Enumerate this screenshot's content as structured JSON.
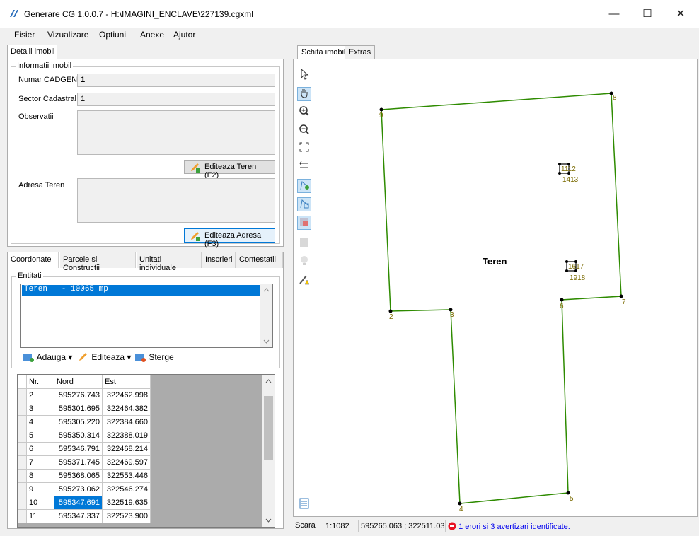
{
  "window": {
    "title": "Generare CG 1.0.0.7 - H:\\IMAGINI_ENCLAVE\\227139.cgxml",
    "minimize": "—",
    "maximize": "☐",
    "close": "✕"
  },
  "menu": [
    "Fisier",
    "Vizualizare",
    "Optiuni",
    "Anexe",
    "Ajutor"
  ],
  "left": {
    "tab": "Detalii imobil",
    "info_group": "Informatii imobil",
    "numar_cadgen_label": "Numar CADGEN",
    "numar_cadgen_value": "1",
    "sector_label": "Sector Cadastral",
    "sector_value": "1",
    "observatii_label": "Observatii",
    "observatii_value": "",
    "editeaza_teren_btn": "Editeaza Teren (F2)",
    "adresa_label": "Adresa Teren",
    "adresa_value": "",
    "editeaza_adresa_btn": "Editeaza Adresa (F3)"
  },
  "bottom_tabs": [
    "Coordonate",
    "Parcele si Constructii",
    "Unitati individuale",
    "Inscrieri",
    "Contestatii"
  ],
  "entitati": {
    "group": "Entitati",
    "selected_item": "Teren   - 10065 mp",
    "adauga": "Adauga",
    "editeaza": "Editeaza",
    "sterge": "Sterge",
    "dropdown_arrow": "▾"
  },
  "coords": {
    "headers": [
      "Nr.",
      "Nord",
      "Est"
    ],
    "rows": [
      [
        "2",
        "595276.743",
        "322462.998"
      ],
      [
        "3",
        "595301.695",
        "322464.382"
      ],
      [
        "4",
        "595305.220",
        "322384.660"
      ],
      [
        "5",
        "595350.314",
        "322388.019"
      ],
      [
        "6",
        "595346.791",
        "322468.214"
      ],
      [
        "7",
        "595371.745",
        "322469.597"
      ],
      [
        "8",
        "595368.065",
        "322553.446"
      ],
      [
        "9",
        "595273.062",
        "322546.274"
      ],
      [
        "10",
        "595347.691",
        "322519.635"
      ],
      [
        "11",
        "595347.337",
        "322523.900"
      ]
    ],
    "selected_row": 8
  },
  "right": {
    "tabs": [
      "Schita imobil",
      "Extras"
    ],
    "label_teren": "Teren",
    "vertex_labels": [
      "2",
      "3",
      "4",
      "5",
      "6",
      "7",
      "8",
      "9"
    ],
    "small_labels": [
      "1112",
      "1413",
      "1617",
      "1918"
    ]
  },
  "status": {
    "scara_label": "Scara",
    "scale": "1:1082",
    "coords": "595265.063 ; 322511.031",
    "errors": "1 erori si 3 avertizari identificate."
  },
  "colors": {
    "accent": "#0078d7",
    "parcel_line": "#2e8b00",
    "error": "#e81123"
  }
}
